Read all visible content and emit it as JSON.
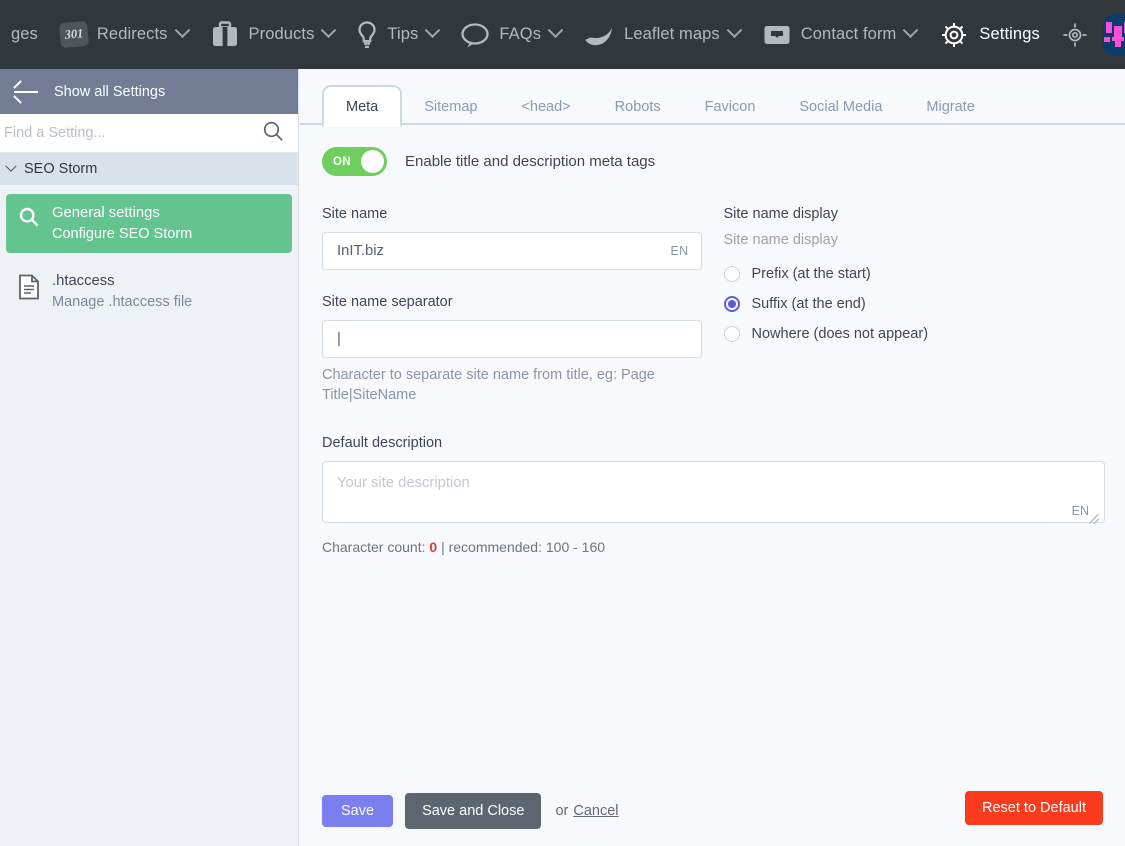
{
  "topbar": {
    "items": [
      {
        "label": "ges",
        "icon": "pages-icon",
        "has_caret": false,
        "active": false,
        "truncated": true
      },
      {
        "label": "Redirects",
        "icon": "301-badge-icon",
        "has_caret": true,
        "active": false
      },
      {
        "label": "Products",
        "icon": "briefcase-icon",
        "has_caret": true,
        "active": false
      },
      {
        "label": "Tips",
        "icon": "lightbulb-icon",
        "has_caret": true,
        "active": false
      },
      {
        "label": "FAQs",
        "icon": "speech-bubble-icon",
        "has_caret": true,
        "active": false
      },
      {
        "label": "Leaflet maps",
        "icon": "leaf-icon",
        "has_caret": true,
        "active": false
      },
      {
        "label": "Contact form",
        "icon": "inbox-icon",
        "has_caret": true,
        "active": false
      },
      {
        "label": "Settings",
        "icon": "gear-icon",
        "has_caret": false,
        "active": true
      }
    ],
    "badge_301": "301",
    "locate_icon": "crosshair-icon",
    "logo": {
      "name": "app-logo",
      "bg": "#0c3c69",
      "fg": "#ff4fd8"
    },
    "bg": "#32373c"
  },
  "sidebar": {
    "back_label": "Show all Settings",
    "search": {
      "value": "",
      "placeholder": "Find a Setting...",
      "icon": "search-icon"
    },
    "group": {
      "label": "SEO Storm",
      "expanded": true
    },
    "entries": [
      {
        "title": "General settings",
        "subtitle": "Configure SEO Storm",
        "icon": "magnifier-icon",
        "selected": true
      },
      {
        "title": ".htaccess",
        "subtitle": "Manage .htaccess file",
        "icon": "document-icon",
        "selected": false
      }
    ],
    "selected_color": "#63c490",
    "bg": "#eef2f7"
  },
  "main": {
    "tabs": [
      {
        "label": "Meta",
        "active": true
      },
      {
        "label": "Sitemap",
        "active": false
      },
      {
        "label": "<head>",
        "active": false
      },
      {
        "label": "Robots",
        "active": false
      },
      {
        "label": "Favicon",
        "active": false
      },
      {
        "label": "Social Media",
        "active": false
      },
      {
        "label": "Migrate",
        "active": false
      }
    ],
    "toggle": {
      "state_label": "ON",
      "checked": true,
      "description": "Enable title and description meta tags",
      "color": "#6fcf5e"
    },
    "site_name": {
      "label": "Site name",
      "value": "InIT.biz",
      "placeholder": "",
      "lang": "EN"
    },
    "site_name_separator": {
      "label": "Site name separator",
      "value": "|",
      "placeholder": "",
      "hint": "Character to separate site name from title, eg: Page Title|SiteName"
    },
    "site_name_display": {
      "label": "Site name display",
      "sublabel": "Site name display",
      "options": [
        {
          "label": "Prefix (at the start)",
          "checked": false
        },
        {
          "label": "Suffix (at the end)",
          "checked": true
        },
        {
          "label": "Nowhere (does not appear)",
          "checked": false
        }
      ],
      "accent": "#5a5ae0"
    },
    "default_description": {
      "label": "Default description",
      "value": "",
      "placeholder": "Your site description",
      "lang": "EN",
      "charcount_prefix": "Character count: ",
      "charcount_value": "0",
      "charcount_suffix": " | recommended: 100 - 160",
      "charcount_color": "#e8392b"
    }
  },
  "footer": {
    "save_label": "Save",
    "save_close_label": "Save and Close",
    "or_label": "or",
    "cancel_label": "Cancel",
    "reset_label": "Reset to Default",
    "save_color": "#7b7ef0",
    "save_close_color": "#5d6670",
    "reset_color": "#fb3b1e"
  }
}
